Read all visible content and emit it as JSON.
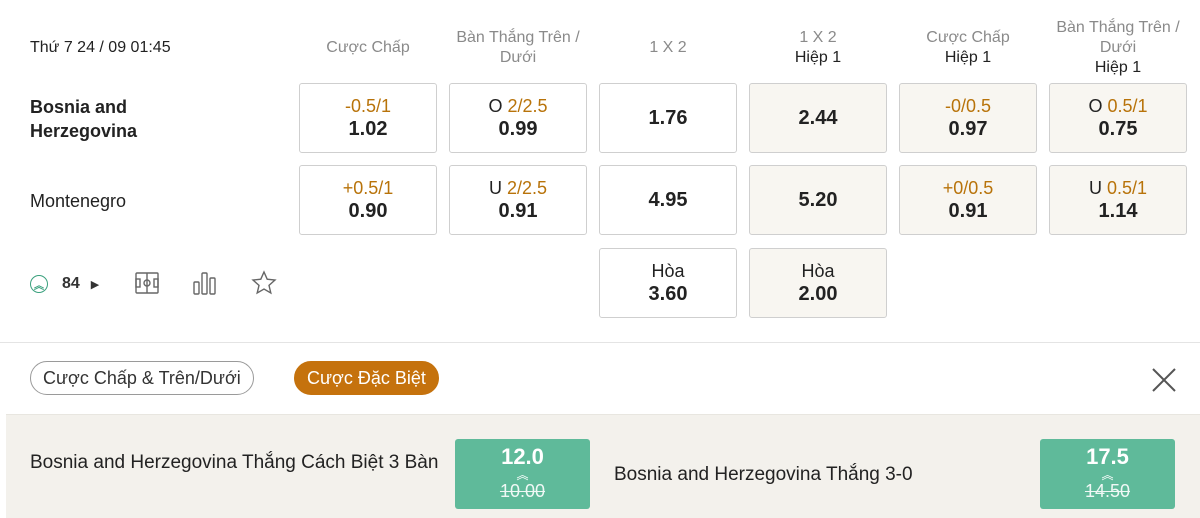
{
  "match": {
    "datetime": "Thứ 7 24 / 09 01:45"
  },
  "columns": [
    {
      "title": "Cược Chấp",
      "subtitle": ""
    },
    {
      "title": "Bàn Thắng Trên / Dưới",
      "subtitle": ""
    },
    {
      "title": "1 X 2",
      "subtitle": ""
    },
    {
      "title": "1 X 2",
      "subtitle": "Hiệp 1"
    },
    {
      "title": "Cược Chấp",
      "subtitle": "Hiệp 1"
    },
    {
      "title": "Bàn Thắng Trên / Dưới",
      "subtitle": "Hiệp 1"
    }
  ],
  "home": {
    "name": "Bosnia and Herzegovina",
    "handicap": {
      "line": "-0.5/1",
      "odds": "1.02"
    },
    "total": {
      "side": "O",
      "line": "2/2.5",
      "odds": "0.99"
    },
    "x12": {
      "odds": "1.76"
    },
    "x12_h1": {
      "odds": "2.44"
    },
    "handicap_h1": {
      "line": "-0/0.5",
      "odds": "0.97"
    },
    "total_h1": {
      "side": "O",
      "line": "0.5/1",
      "odds": "0.75"
    }
  },
  "away": {
    "name": "Montenegro",
    "handicap": {
      "line": "+0.5/1",
      "odds": "0.90"
    },
    "total": {
      "side": "U",
      "line": "2/2.5",
      "odds": "0.91"
    },
    "x12": {
      "odds": "4.95"
    },
    "x12_h1": {
      "odds": "5.20"
    },
    "handicap_h1": {
      "line": "+0/0.5",
      "odds": "0.91"
    },
    "total_h1": {
      "side": "U",
      "line": "0.5/1",
      "odds": "1.14"
    }
  },
  "draw": {
    "x12": {
      "label": "Hòa",
      "odds": "3.60"
    },
    "x12_h1": {
      "label": "Hòa",
      "odds": "2.00"
    }
  },
  "stats": {
    "count": "84"
  },
  "icons": [
    "field-icon",
    "bar-chart-icon",
    "star-icon",
    "close-icon"
  ],
  "tabs": [
    {
      "label": "Cược Chấp & Trên/Dưới",
      "active": false
    },
    {
      "label": "Cược Đặc Biệt",
      "active": true
    }
  ],
  "specials": [
    {
      "label": "Bosnia and Herzegovina Thắng Cách Biệt 3 Bàn",
      "new_odds": "12.0",
      "old_odds": "10.00"
    },
    {
      "label": "Bosnia and Herzegovina Thắng 3-0",
      "new_odds": "17.5",
      "old_odds": "14.50"
    }
  ],
  "colors": {
    "accent": "#c5720d",
    "handicap_text": "#b8730a",
    "boosted": "#5fba9a",
    "alt_cell": "#f8f6f1"
  }
}
